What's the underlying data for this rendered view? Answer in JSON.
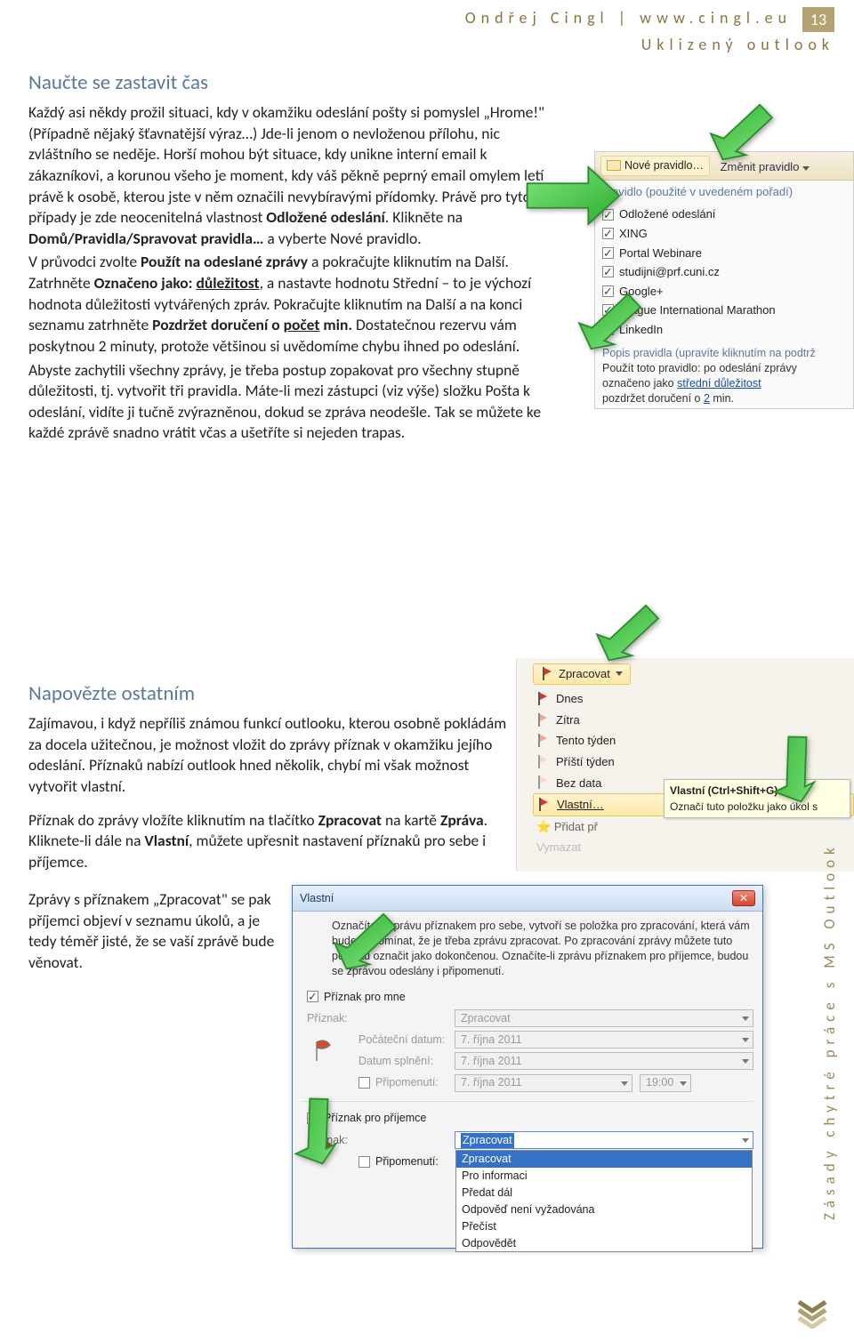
{
  "header": {
    "author": "Ondřej Cingl",
    "site": "www.cingl.eu",
    "page": "13",
    "subtitle": "Uklizený outlook"
  },
  "sec1": {
    "title": "Naučte se zastavit čas",
    "body": "Každý asi někdy prožil situaci, kdy v okamžiku odeslání pošty si pomyslel „Hrome!\" (Případně nějaký šťavnatější výraz…) Jde-li jenom o nevloženou přílohu, nic zvláštního se neděje. Horší mohou být situace, kdy unikne interní email k zákazníkovi, a korunou všeho je moment, kdy váš pěkně peprný email omylem letí právě k osobě, kterou jste v něm označili nevybíravými přídomky. Právě pro tyto případy je zde neocenitelná vlastnost ",
    "b1": "Odložené odeslání",
    "body2": ". Klikněte na ",
    "b2": "Domů/Pravidla/Spravovat pravidla…",
    "body3": " a vyberte Nové pravidlo.",
    "body4a": "V průvodci zvolte ",
    "b3": "Použít na odeslané zprávy",
    "body4b": " a pokračujte kliknutím na Další. Zatrhněte ",
    "b4": "Označeno jako: ",
    "b4u": "důležitost",
    "body4c": ", a nastavte hodnotu Střední – to je výchozí hodnota důležitosti vytvářených zpráv. Pokračujte kliknutím na Další a na konci seznamu zatrhněte ",
    "b5": "Pozdržet doručení o ",
    "b5u": "počet",
    "b5b": " min.",
    "body5": " Dostatečnou rezervu vám poskytnou 2 minuty, protože většinou si uvědomíme chybu ihned po odeslání.",
    "body6": "Abyste zachytili všechny zprávy, je třeba postup zopakovat pro všechny stupně důležitosti, tj. vytvořit tři pravidla. Máte-li mezi zástupci (viz výše) složku Pošta k odeslání, vidíte ji tučně zvýrazněnou, dokud se zpráva neodešle. Tak se můžete ke každé zprávě snadno vrátit včas a ušetříte si nejeden trapas."
  },
  "fig1": {
    "btn1": "Nové pravidlo…",
    "btn2": "Změnit pravidlo",
    "caption": "Pravidlo (použité v uvedeném pořadí)",
    "items": [
      "Odložené odeslání",
      "XING",
      "Portal Webinare",
      "studijni@prf.cuni.cz",
      "Google+",
      "Prague International Marathon",
      "LinkedIn"
    ],
    "descT": "Popis pravidla (upravíte kliknutím na podtrž",
    "desc1": "Použít toto pravidlo: po odeslání zprávy",
    "desc2a": "označeno jako ",
    "desc2b": "střední důležitost",
    "desc3a": "pozdržet doručení o ",
    "desc3b": "2",
    "desc3c": " min."
  },
  "sec2": {
    "title": "Napovězte ostatním",
    "body1": "Zajímavou, i když nepříliš známou funkcí outlooku, kterou osobně pokládám za docela užitečnou, je možnost vložit do zprávy příznak v okamžiku jejího odeslání. Příznaků nabízí outlook hned několik, chybí mi však možnost vytvořit vlastní.",
    "body2a": "Příznak do zprávy vložíte kliknutím na tlačítko ",
    "b1": "Zpracovat",
    "body2b": " na kartě ",
    "b2": "Zpráva",
    "body2c": ". Kliknete-li dále na ",
    "b3": "Vlastní",
    "body2d": ", můžete upřesnit nastavení příznaků pro sebe i příjemce.",
    "body3": "Zprávy s příznakem „Zpracovat\" se pak příjemci objeví v seznamu úkolů, a je tedy téměř jisté, že se vaší zprávě bude věnovat."
  },
  "fig2": {
    "ribbon": "Zpracovat",
    "items": [
      "Dnes",
      "Zítra",
      "Tento týden",
      "Příští týden",
      "Bez data",
      "Vlastní…"
    ],
    "addFlag": "Přidat př",
    "clear": "Vymazat",
    "tipTitle": "Vlastní (Ctrl+Shift+G)",
    "tipBody": "Označí tuto položku jako úkol s"
  },
  "dialog": {
    "title": "Vlastní",
    "intro": "Označíte-li zprávu příznakem pro sebe, vytvoří se položka pro zpracování, která vám bude připomínat, že je třeba zprávu zpracovat. Po zpracování zprávy můžete tuto položku označit jako dokončenou. Označíte-li zprávu příznakem pro příjemce, budou se zprávou odeslány i připomenutí.",
    "chk1": "Příznak pro mne",
    "chk2": "Příznak pro příjemce",
    "lblFlag": "Příznak:",
    "lblStart": "Počáteční datum:",
    "lblDue": "Datum splnění:",
    "lblRem": "Připomenutí:",
    "valFlag": "Zpracovat",
    "valDate": "7. října 2011",
    "valTime": "19:00",
    "chkRem": "Připomenutí:",
    "options": [
      "Zpracovat",
      "Pro informaci",
      "Předat dál",
      "Odpověď není vyžadována",
      "Přečíst",
      "Odpovědět"
    ]
  },
  "side": "Zásady chytré práce s MS Outlook"
}
